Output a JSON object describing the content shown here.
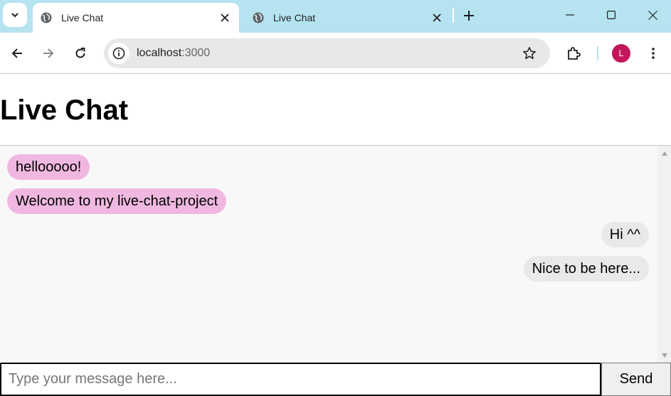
{
  "browser": {
    "tabs": [
      {
        "title": "Live Chat",
        "active": true
      },
      {
        "title": "Live Chat",
        "active": false
      }
    ],
    "address": {
      "host": "localhost",
      "port": ":3000"
    },
    "profile_initial": "L",
    "accent_color": "#b5e4f0",
    "icons": [
      "tab-search-icon",
      "globe-icon",
      "close-icon",
      "plus-icon",
      "minimize-icon",
      "maximize-icon",
      "window-close-icon",
      "back-arrow-icon",
      "forward-arrow-icon",
      "reload-icon",
      "info-icon",
      "star-icon",
      "extensions-icon",
      "kebab-menu-icon"
    ]
  },
  "page": {
    "title": "Live Chat",
    "messages": [
      {
        "text": "hellooooo!",
        "side": "received"
      },
      {
        "text": "Welcome to my live-chat-project",
        "side": "received"
      },
      {
        "text": "Hi ^^",
        "side": "sent"
      },
      {
        "text": "Nice to be here...",
        "side": "sent"
      }
    ],
    "received_bubble_color": "#f0b8e0",
    "sent_bubble_color": "#ebe8eb",
    "composer": {
      "placeholder": "Type your message here...",
      "value": "",
      "send_label": "Send"
    }
  }
}
